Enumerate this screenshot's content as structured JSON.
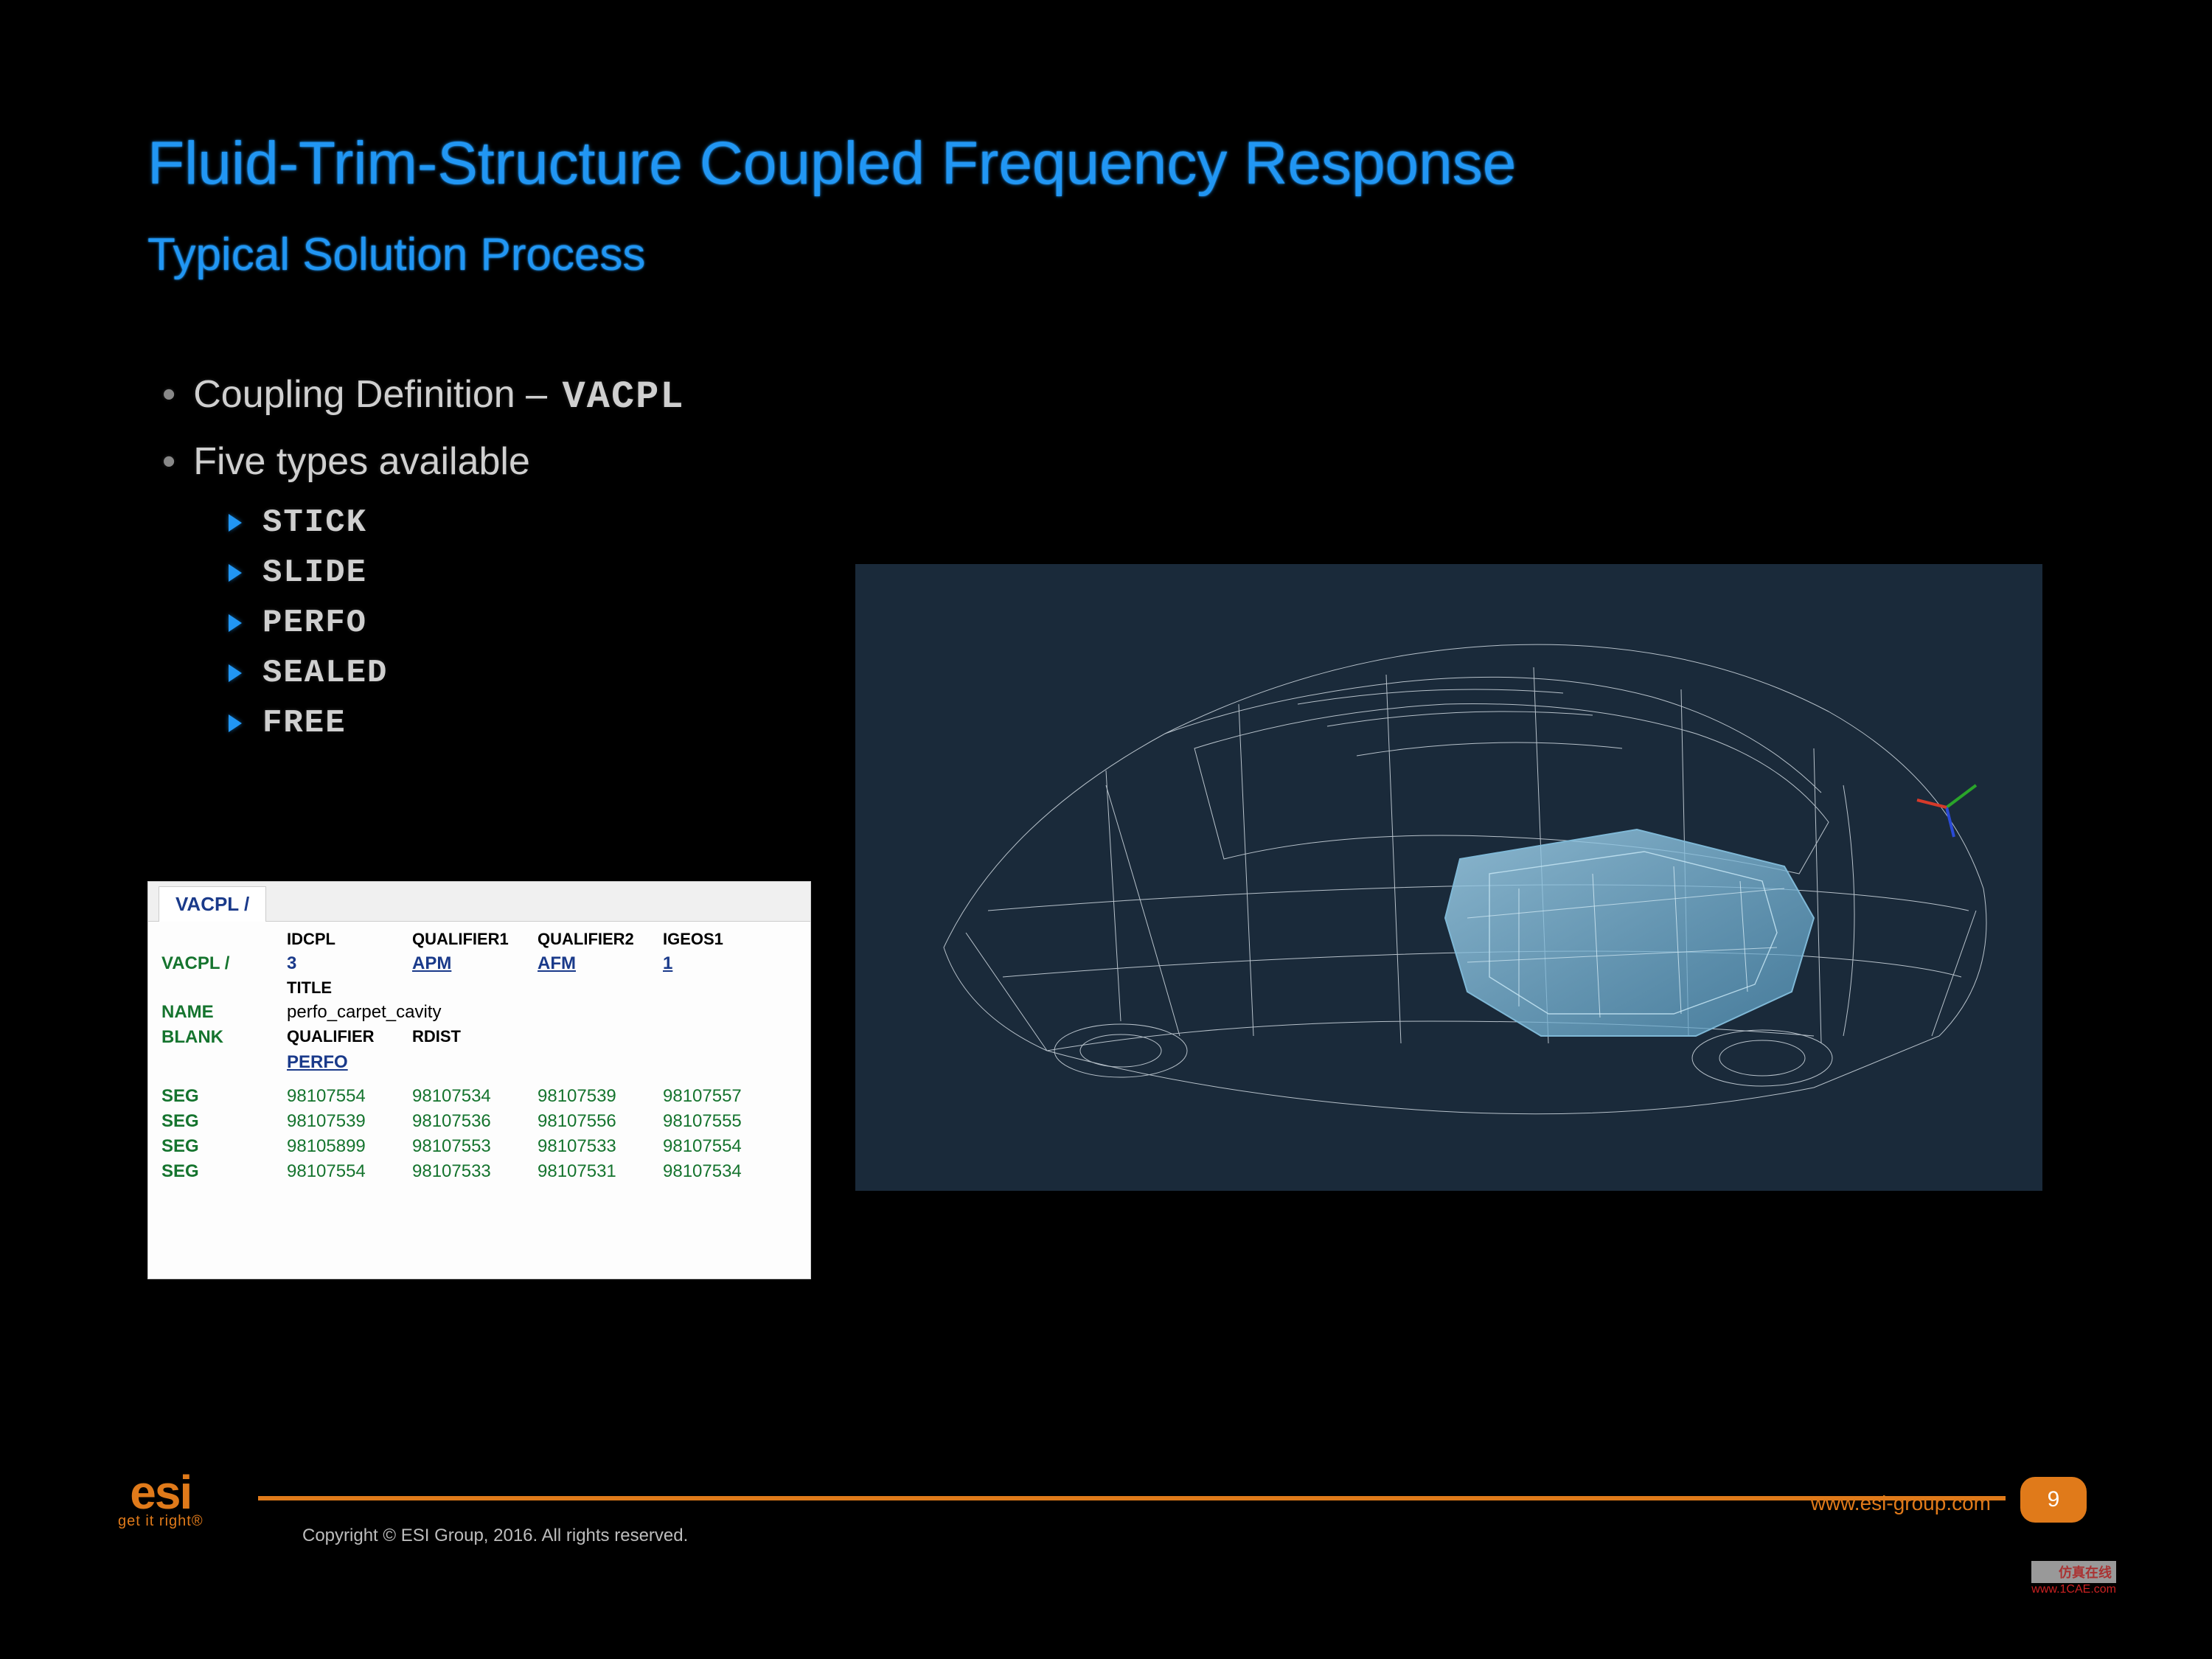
{
  "title": "Fluid-Trim-Structure Coupled Frequency Response",
  "subtitle": "Typical Solution Process",
  "bullets": {
    "b1a_pre": "Coupling Definition – ",
    "b1a_bold": "VACPL",
    "b1b": "Five types available",
    "sub": [
      "STICK",
      "SLIDE",
      "PERFO",
      "SEALED",
      "FREE"
    ]
  },
  "table": {
    "tab": "VACPL /",
    "headers": [
      "IDCPL",
      "QUALIFIER1",
      "QUALIFIER2",
      "IGEOS1"
    ],
    "row_vacpl_label": "VACPL /",
    "row_vacpl": [
      "3",
      "APM",
      "AFM",
      "1"
    ],
    "title_hdr": "TITLE",
    "name_label": "NAME",
    "name_value": "perfo_carpet_cavity",
    "blank_label": "BLANK",
    "blank_h1": "QUALIFIER",
    "blank_h2": "RDIST",
    "blank_v1": "PERFO",
    "seg_label": "SEG",
    "segs": [
      [
        "98107554",
        "98107534",
        "98107539",
        "98107557"
      ],
      [
        "98107539",
        "98107536",
        "98107556",
        "98107555"
      ],
      [
        "98105899",
        "98107553",
        "98107533",
        "98107554"
      ],
      [
        "98107554",
        "98107533",
        "98107531",
        "98107534"
      ]
    ]
  },
  "viz_alt": "Wireframe vehicle body with rear cabin/cavity volume highlighted",
  "footer": {
    "logo_text": "esi",
    "logo_tag": "get it right®",
    "url": "www.esi-group.com",
    "page": "9",
    "copyright": "Copyright © ESI Group, 2016. All rights reserved."
  },
  "watermark": {
    "line1": "仿真在线",
    "line2": "www.1CAE.com"
  }
}
